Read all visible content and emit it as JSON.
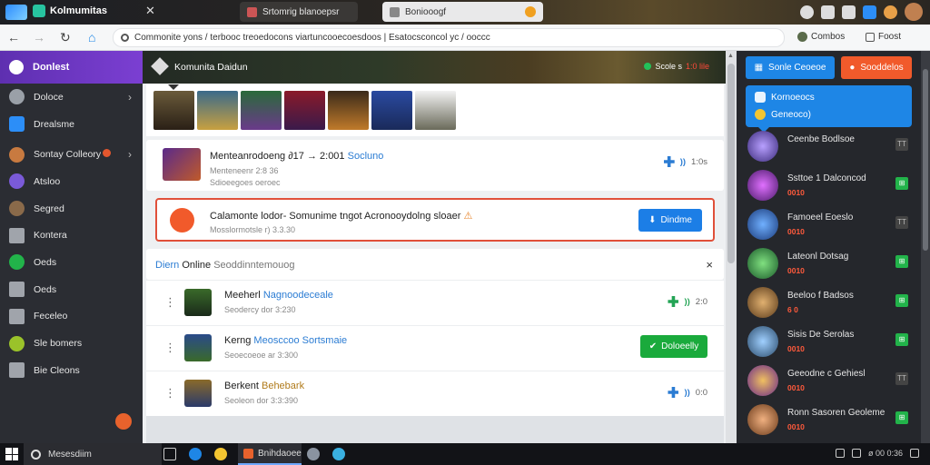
{
  "app": {
    "title": "Kolmumitas"
  },
  "tabs": [
    {
      "label": "Srtomrig blanoepsr"
    },
    {
      "label": "Boniooogf"
    }
  ],
  "address": {
    "url": "Commonite yons / terbooc treoedocons viartuncooecoesdoos  |  Esatocsconcol yc / ooccc",
    "bookmark1": "Combos",
    "bookmark2": "Foost"
  },
  "sidebar": {
    "header": "Donlest",
    "items": [
      {
        "label": "Doloce",
        "chevron": "›"
      },
      {
        "label": "Drealsme"
      },
      {
        "label": "Sontay Colleory",
        "chevron": "›"
      },
      {
        "label": "Atsloo"
      },
      {
        "label": "Segred"
      },
      {
        "label": "Kontera"
      },
      {
        "label": "Oeds"
      },
      {
        "label": "Oeds"
      },
      {
        "label": "Feceleo"
      },
      {
        "label": "Sle bomers"
      },
      {
        "label": "Bie Cleons"
      }
    ]
  },
  "banner": {
    "title": "Komunita Daidun",
    "status": "Scole s",
    "status_alert": "1:0 lile"
  },
  "item1": {
    "title": "Menteanrodoeng ∂17 → 2:001",
    "title_link": "Socluno",
    "subtitle": "Menteneenr 2:8 36",
    "subtitle2": "Sdioeegoes oeroec",
    "meta": "1:0s"
  },
  "alert": {
    "title": "Calamonte lodor- Somunime tngot  Acronooydolng sloaer",
    "warn": "⚠",
    "subtitle": "Mosslormotsle r) 3.3.30",
    "button": "Dindme"
  },
  "online": {
    "hl": "Diern",
    "title": "Online",
    "muted": "Seoddinntemouog",
    "close": "×",
    "rows": [
      {
        "name": "Meeherl",
        "name_link": "Nagnoodeceale",
        "sub": "Seodercy dor 3:230",
        "meta": "2:0"
      },
      {
        "name": "Kerng",
        "name_link": "Meosccoo Sortsmaie",
        "sub": "Seoecoeoe ar 3:300",
        "button": "Doloeelly"
      },
      {
        "name": "Berkent",
        "name_link": "Behebark",
        "sub": "Seoleon dor 3:3:390",
        "meta": "0:0"
      }
    ]
  },
  "right": {
    "btn1": "Sonle Ceoeoe",
    "btn2": "Sooddelos",
    "card_line1": "Kornoeocs",
    "card_line2": "Geneoco)",
    "friends": [
      {
        "name": "Ceenbe Bodlsoe",
        "status": "",
        "on": false
      },
      {
        "name": "Ssttoe 1 Dalconcod",
        "status": "0010",
        "on": true
      },
      {
        "name": "Famoeel Eoeslo",
        "status": "0010",
        "on": false
      },
      {
        "name": "Lateonl Dotsag",
        "status": "0010",
        "on": true
      },
      {
        "name": "Beeloo f Badsos",
        "status": "6 0",
        "on": true
      },
      {
        "name": "Sisis De Serolas",
        "status": "0010",
        "on": true
      },
      {
        "name": "Geeodne c Gehiesl",
        "status": "0010",
        "on": false
      },
      {
        "name": "Ronn Sasoren Geoleme",
        "status": "0010",
        "on": true
      }
    ]
  },
  "taskbar": {
    "search": "Mesesdiim",
    "app": "Bnihdaoee",
    "tray": "ø 00  0:36"
  },
  "colors": {
    "accent_blue": "#1e86e6",
    "accent_orange": "#f15a2b",
    "accent_green": "#1aaa3c",
    "sidebar_purple": "#6a35c2"
  }
}
